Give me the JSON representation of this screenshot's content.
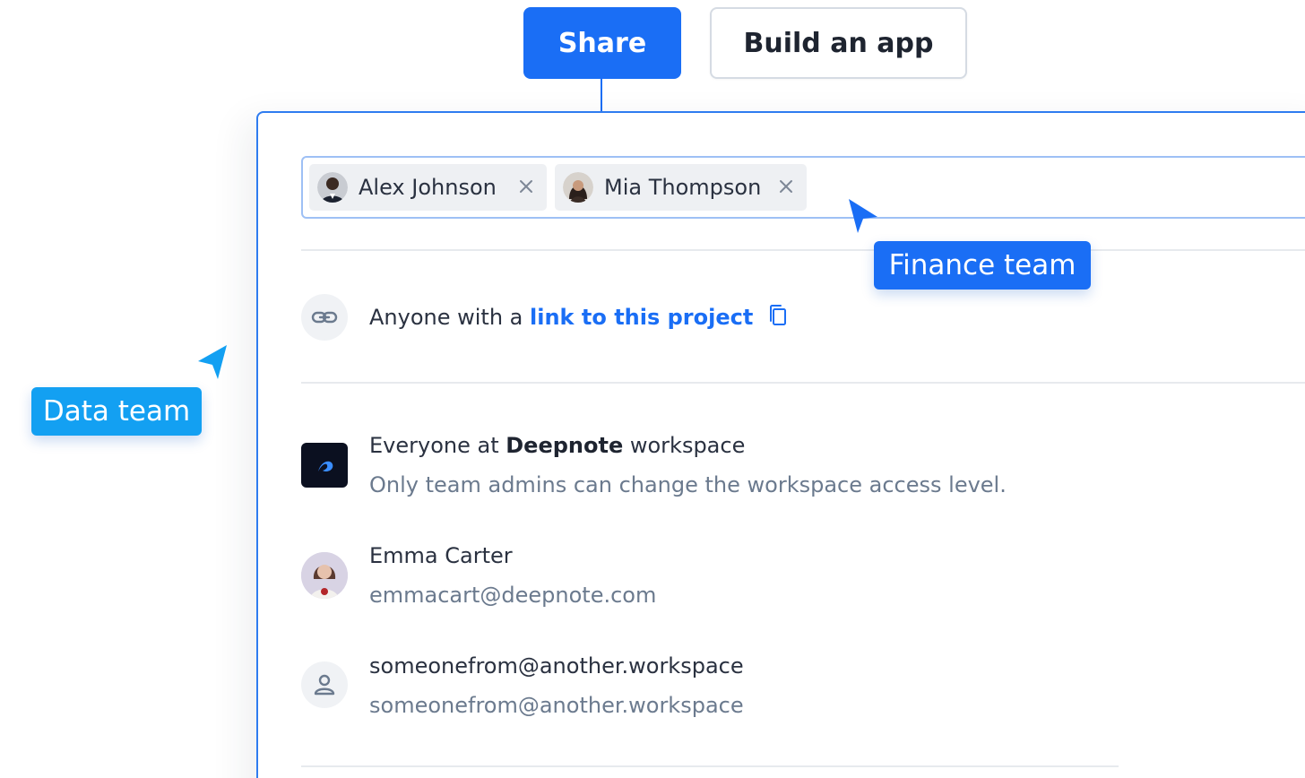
{
  "tabs": {
    "share_label": "Share",
    "build_label": "Build an app"
  },
  "invite": {
    "chips": [
      {
        "name": "Alex Johnson"
      },
      {
        "name": "Mia Thompson"
      }
    ]
  },
  "link_row": {
    "prefix": "Anyone with a ",
    "link_text": "link to this project"
  },
  "workspace_row": {
    "prefix": "Everyone at ",
    "workspace_name": "Deepnote",
    "suffix": " workspace",
    "note": "Only team admins can change the workspace access level."
  },
  "members": [
    {
      "name": "Emma Carter",
      "email": "emmacart@deepnote.com"
    },
    {
      "name": "someonefrom@another.workspace",
      "email": "someonefrom@another.workspace"
    }
  ],
  "cursors": {
    "finance": {
      "label": "Finance team",
      "color": "#1a6ef5"
    },
    "data": {
      "label": "Data team",
      "color": "#13a0f2"
    }
  },
  "icons": {
    "link": "link-icon",
    "copy": "copy-icon",
    "user": "user-icon",
    "remove": "close-icon",
    "workspace_logo": "deepnote-logo-icon"
  },
  "colors": {
    "accent": "#1a6ef5",
    "data_team": "#13a0f2",
    "panel_border": "#2f7cf0"
  }
}
